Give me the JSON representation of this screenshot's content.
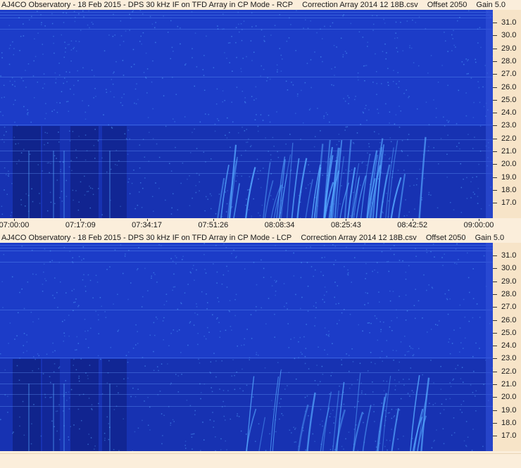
{
  "panels": [
    {
      "id": "rcp",
      "title": {
        "observatory": "AJ4CO Observatory - 18 Feb 2015 - DPS 30 kHz IF on TFD Array in CP Mode - RCP",
        "correction": "Correction Array 2014 12 18B.csv",
        "offset": "Offset 2050",
        "gain": "Gain 5.0"
      },
      "yticks": [
        "31.0",
        "30.0",
        "29.0",
        "28.0",
        "27.0",
        "26.0",
        "25.0",
        "24.0",
        "23.0",
        "22.0",
        "21.0",
        "20.0",
        "19.0",
        "18.0",
        "17.0"
      ],
      "xticks": [
        "07:00:00",
        "07:17:09",
        "07:34:17",
        "07:51:26",
        "08:08:34",
        "08:25:43",
        "08:42:52",
        "09:00:00"
      ]
    },
    {
      "id": "lcp",
      "title": {
        "observatory": "AJ4CO Observatory - 18 Feb 2015 - DPS 30 kHz IF on TFD Array in CP Mode - LCP",
        "correction": "Correction Array 2014 12 18B.csv",
        "offset": "Offset 2050",
        "gain": "Gain 5.0"
      },
      "yticks": [
        "31.0",
        "30.0",
        "29.0",
        "28.0",
        "27.0",
        "26.0",
        "25.0",
        "24.0",
        "23.0",
        "22.0",
        "21.0",
        "20.0",
        "19.0",
        "18.0",
        "17.0"
      ]
    }
  ],
  "colors": {
    "spectrogram_base": "#1c3cc8",
    "spectrogram_dark": "#0f1f8a",
    "spectrogram_bright": "#55a8ff",
    "axis_background": "#f7e4c8"
  },
  "icons": []
}
